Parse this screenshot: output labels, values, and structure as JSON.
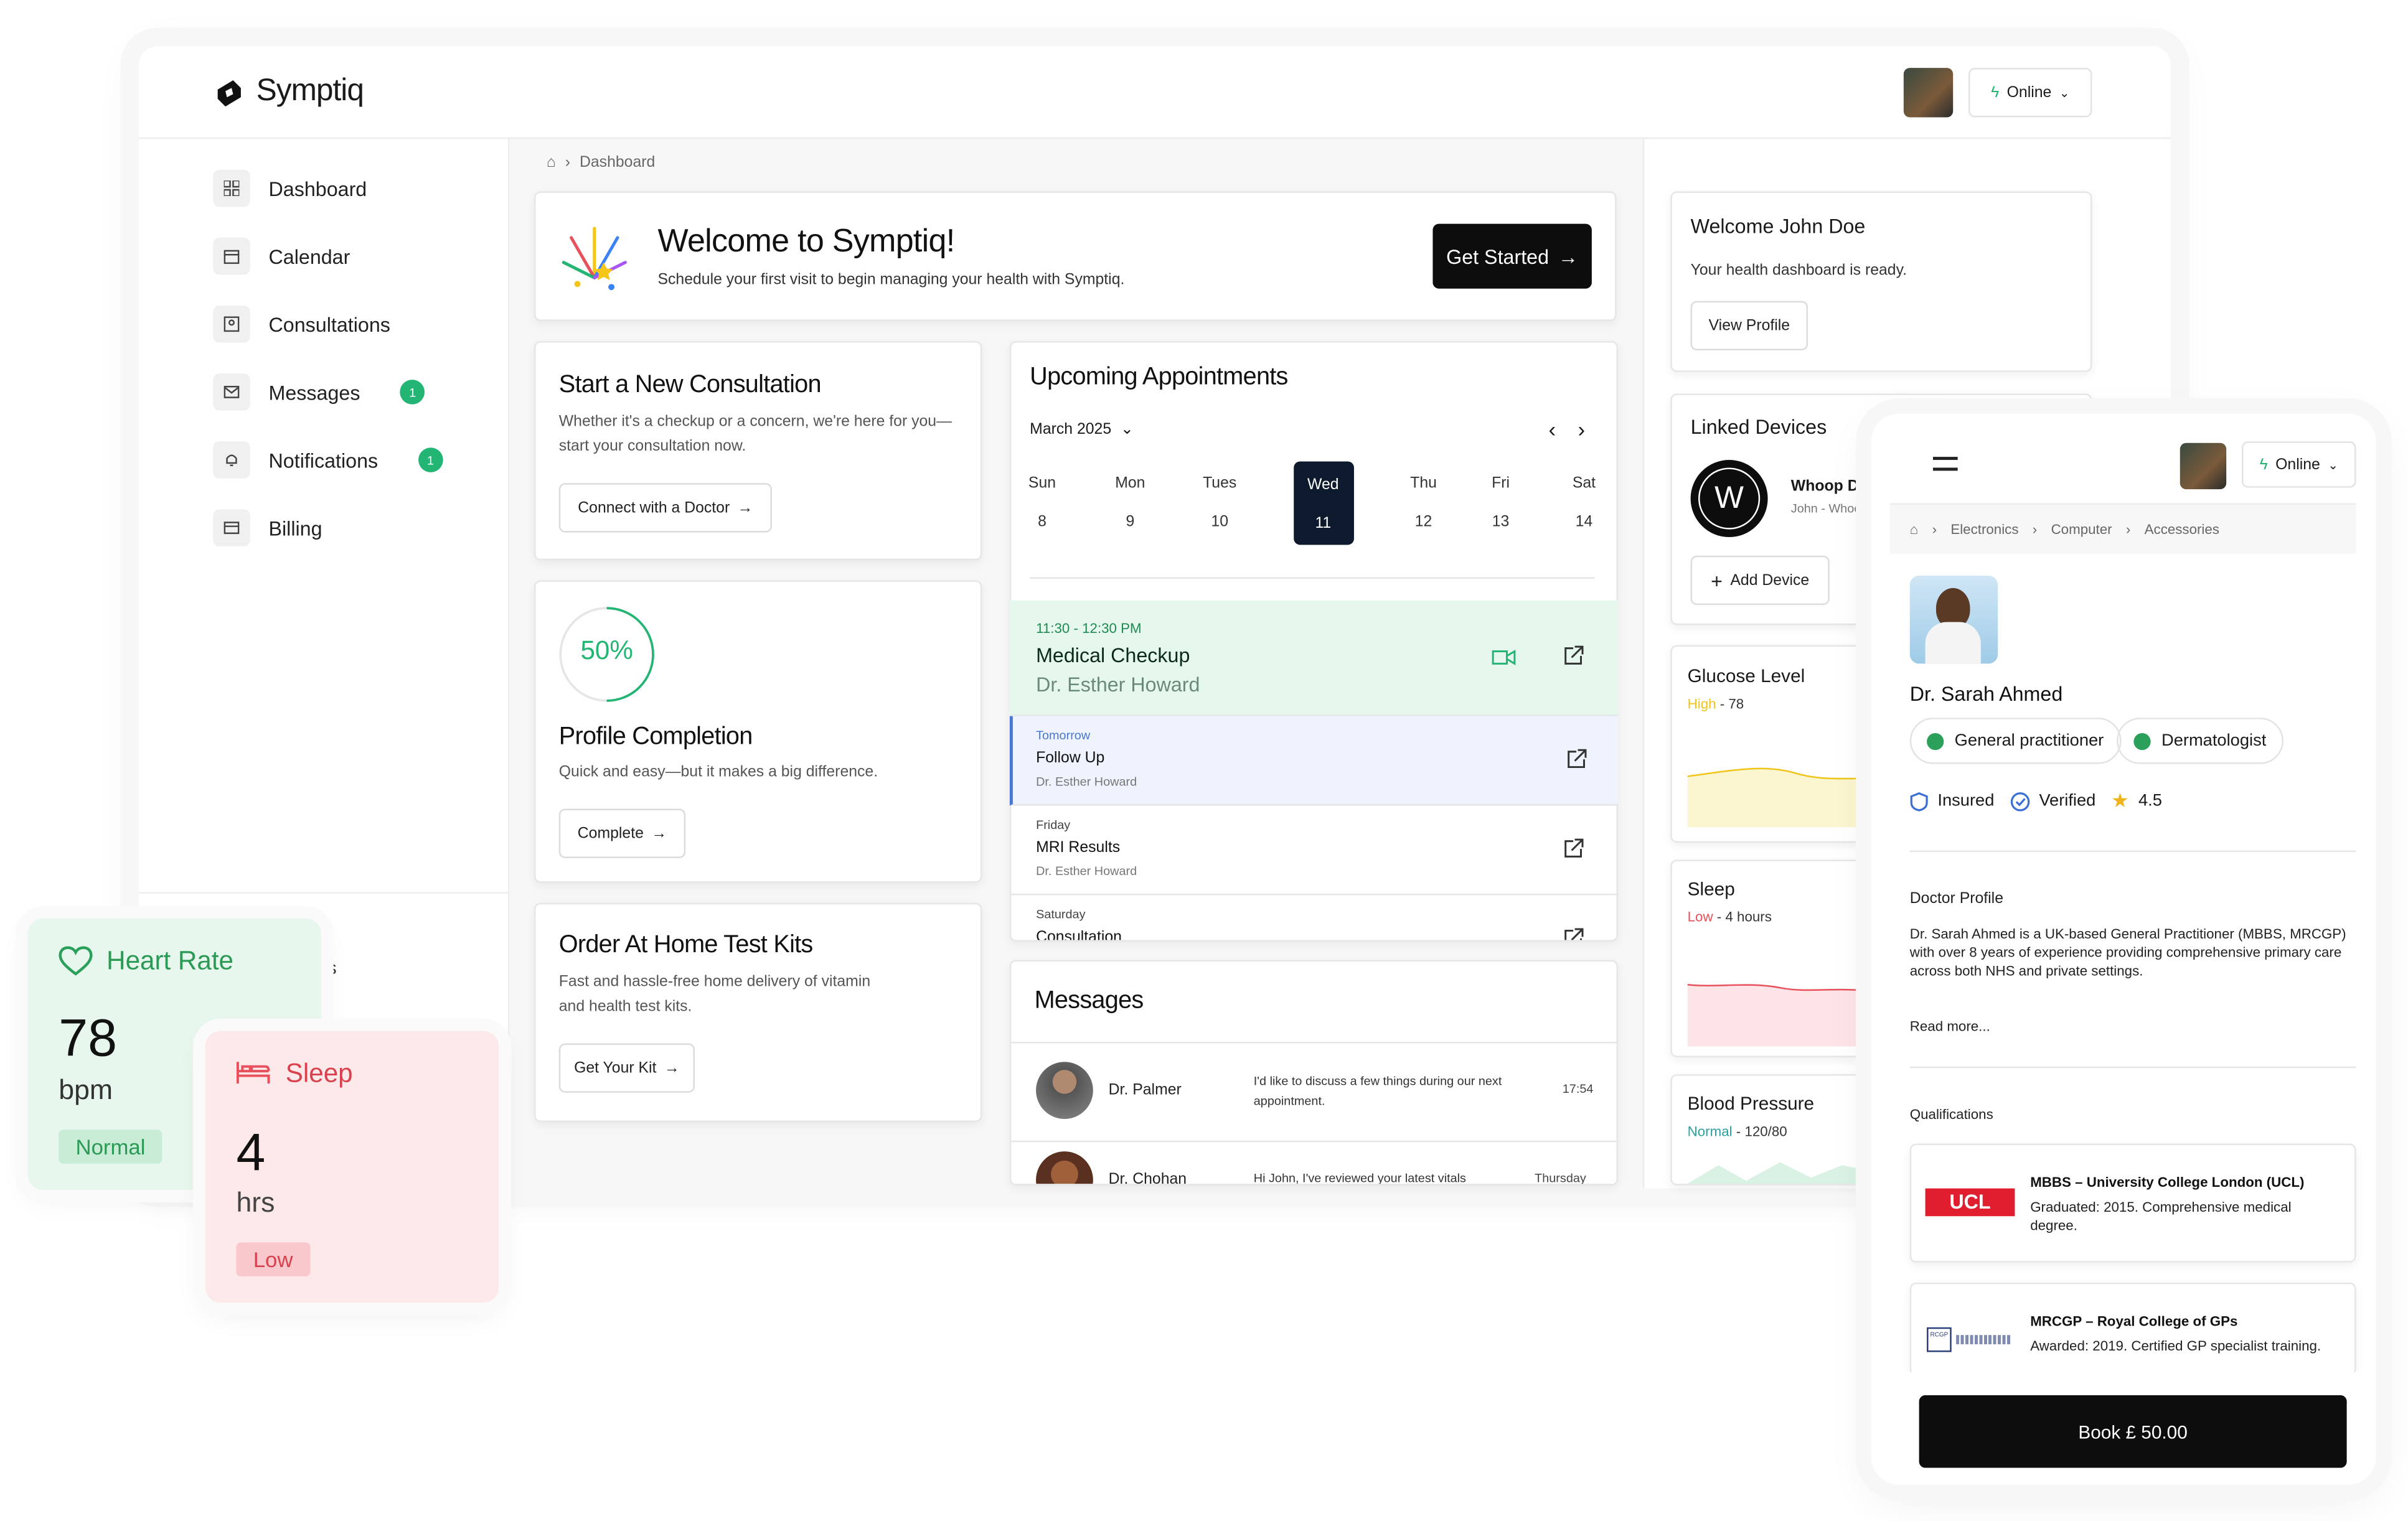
{
  "app": {
    "name": "Symptiq",
    "status": "Online"
  },
  "sidebar": {
    "items": [
      {
        "label": "Dashboard"
      },
      {
        "label": "Calendar"
      },
      {
        "label": "Consultations"
      },
      {
        "label": "Messages",
        "badge": "1"
      },
      {
        "label": "Notifications",
        "badge": "1"
      },
      {
        "label": "Billing"
      }
    ],
    "partial": "s"
  },
  "breadcrumb": {
    "current": "Dashboard"
  },
  "welcome": {
    "title": "Welcome to Symptiq!",
    "subtitle": "Schedule your first visit to begin managing your health with Symptiq.",
    "button": "Get Started"
  },
  "consultation": {
    "title": "Start a New Consultation",
    "text": "Whether it's a checkup or a concern, we're here for you—start your consultation now.",
    "button": "Connect with a Doctor"
  },
  "profile": {
    "percent": "50%",
    "progress": 0.5,
    "title": "Profile Completion",
    "text": "Quick and easy—but it makes a big difference.",
    "button": "Complete"
  },
  "kits": {
    "title": "Order At Home Test Kits",
    "text": "Fast and hassle-free home delivery of vitamin and health test kits.",
    "button": "Get Your Kit"
  },
  "appointments": {
    "title": "Upcoming Appointments",
    "month": "March 2025",
    "days": [
      {
        "d": "Sun",
        "n": "8"
      },
      {
        "d": "Mon",
        "n": "9"
      },
      {
        "d": "Tues",
        "n": "10"
      },
      {
        "d": "Wed",
        "n": "11"
      },
      {
        "d": "Thu",
        "n": "12"
      },
      {
        "d": "Fri",
        "n": "13"
      },
      {
        "d": "Sat",
        "n": "14"
      }
    ],
    "items": [
      {
        "when": "11:30 - 12:30 PM",
        "title": "Medical Checkup",
        "doctor": "Dr. Esther Howard"
      },
      {
        "when": "Tomorrow",
        "title": "Follow Up",
        "doctor": "Dr. Esther Howard"
      },
      {
        "when": "Friday",
        "title": "MRI Results",
        "doctor": "Dr. Esther Howard"
      },
      {
        "when": "Saturday",
        "title": "Consultation"
      }
    ]
  },
  "messages": {
    "title": "Messages",
    "items": [
      {
        "name": "Dr. Palmer",
        "text": "I'd like to discuss a few things during our next appointment.",
        "time": "17:54"
      },
      {
        "name": "Dr. Chohan",
        "text": "Hi John, I've reviewed your latest vitals",
        "time": "Thursday"
      }
    ]
  },
  "right": {
    "welcome_title": "Welcome John Doe",
    "welcome_text": "Your health dashboard is ready.",
    "view_profile": "View Profile",
    "devices_title": "Linked Devices",
    "device_name": "Whoop Device",
    "device_sub": "John - Whoop",
    "add_device": "Add Device",
    "glucose": {
      "title": "Glucose Level",
      "status": "High",
      "value": "78"
    },
    "sleep": {
      "title": "Sleep",
      "status": "Low",
      "value": "4 hours"
    },
    "bp": {
      "title": "Blood Pressure",
      "status": "Normal",
      "value": "120/80"
    }
  },
  "heart": {
    "title": "Heart Rate",
    "value": "78",
    "unit": "bpm",
    "status": "Normal"
  },
  "sleepcard": {
    "title": "Sleep",
    "value": "4",
    "unit": "hrs",
    "status": "Low"
  },
  "mobile": {
    "status": "Online",
    "crumbs": [
      "Electronics",
      "Computer",
      "Accessories"
    ],
    "doctor": "Dr. Sarah Ahmed",
    "tags": [
      "General practitioner",
      "Dermatologist"
    ],
    "insured": "Insured",
    "verified": "Verified",
    "rating": "4.5",
    "profile_title": "Doctor Profile",
    "profile_text": "Dr. Sarah Ahmed is a UK-based General Practitioner (MBBS, MRCGP) with over 8 years of experience providing comprehensive primary care across both NHS and private settings.",
    "read_more": "Read more...",
    "qual_title": "Qualifications",
    "quals": [
      {
        "logo": "UCL",
        "title": "MBBS – University College London (UCL)",
        "text": "Graduated: 2015. Comprehensive medical degree."
      },
      {
        "logo": "RCGP",
        "title": "MRCGP – Royal College of GPs",
        "text": "Awarded: 2019. Certified GP specialist training."
      }
    ],
    "book": "Book £ 50.00"
  },
  "colors": {
    "accent": "#22b573",
    "dark": "#0d0d0d",
    "high": "#f0c419",
    "low": "#e8505b",
    "normal": "#2aa05a"
  }
}
